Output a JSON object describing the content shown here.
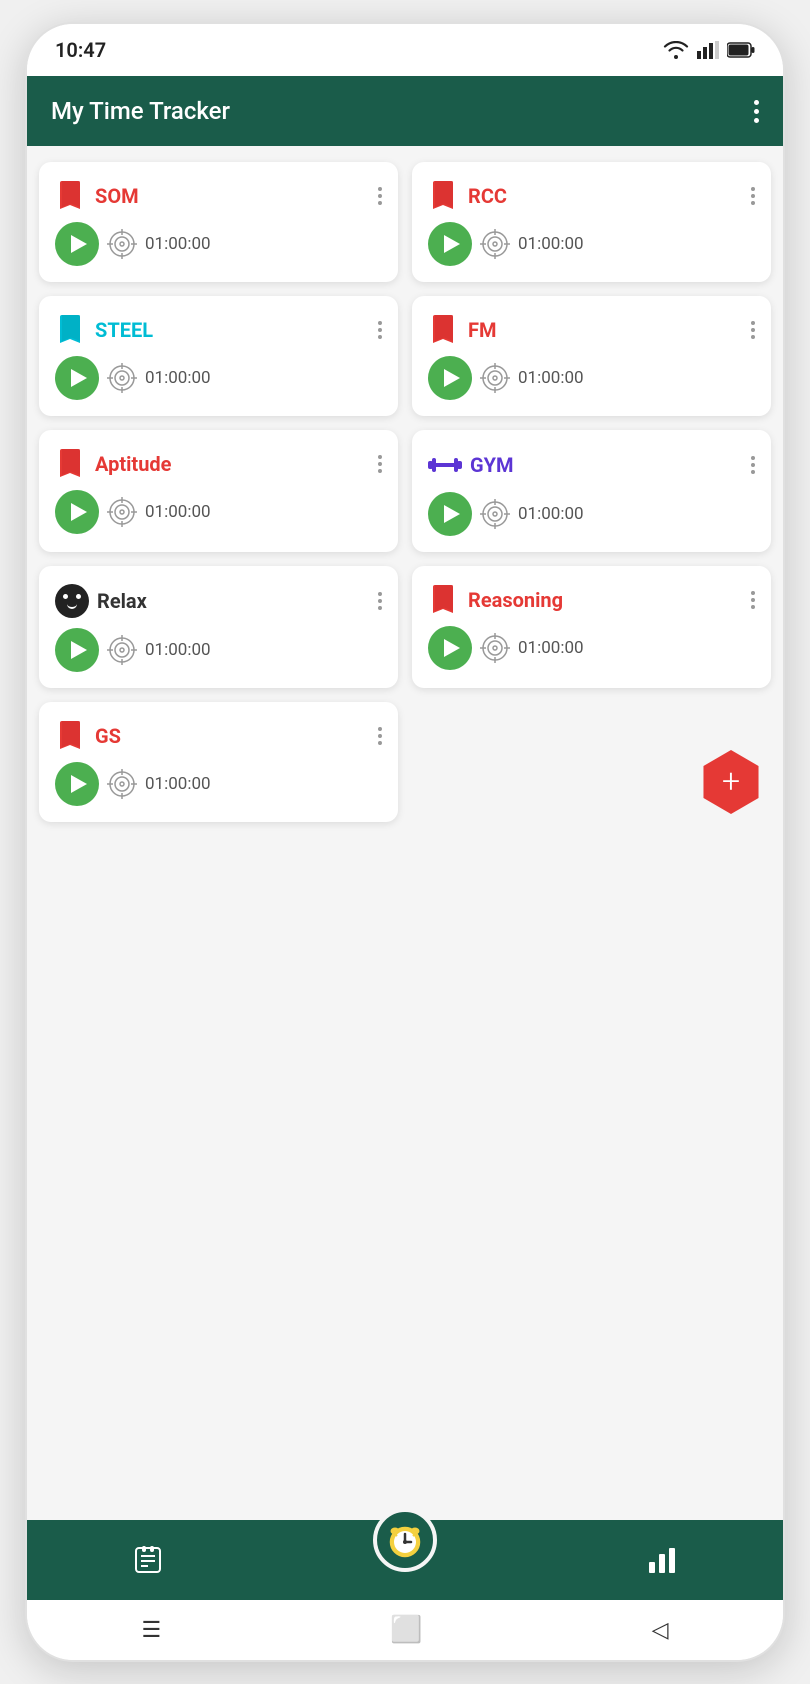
{
  "statusBar": {
    "time": "10:47"
  },
  "appBar": {
    "title": "My Time Tracker"
  },
  "cards": [
    {
      "id": "som",
      "title": "SOM",
      "titleColor": "red",
      "iconType": "book-red",
      "timer": "01:00:00"
    },
    {
      "id": "rcc",
      "title": "RCC",
      "titleColor": "red",
      "iconType": "book-red",
      "timer": "01:00:00"
    },
    {
      "id": "steel",
      "title": "STEEL",
      "titleColor": "cyan",
      "iconType": "book-cyan",
      "timer": "01:00:00"
    },
    {
      "id": "fm",
      "title": "FM",
      "titleColor": "red",
      "iconType": "book-red",
      "timer": "01:00:00"
    },
    {
      "id": "aptitude",
      "title": "Aptitude",
      "titleColor": "red",
      "iconType": "book-red",
      "timer": "01:00:00"
    },
    {
      "id": "gym",
      "title": "GYM",
      "titleColor": "purple",
      "iconType": "dumbbell",
      "timer": "01:00:00"
    },
    {
      "id": "relax",
      "title": "Relax",
      "titleColor": "dark",
      "iconType": "face",
      "timer": "01:00:00"
    },
    {
      "id": "reasoning",
      "title": "Reasoning",
      "titleColor": "red",
      "iconType": "book-red",
      "timer": "01:00:00"
    },
    {
      "id": "gs",
      "title": "GS",
      "titleColor": "red",
      "iconType": "book-red",
      "timer": "01:00:00"
    }
  ],
  "fab": {
    "label": "+"
  },
  "bottomNav": {
    "items": [
      {
        "id": "list",
        "label": "list"
      },
      {
        "id": "clock",
        "label": "clock"
      },
      {
        "id": "chart",
        "label": "chart"
      }
    ]
  },
  "systemNav": {
    "menu": "☰",
    "home": "⬜",
    "back": "◁"
  }
}
